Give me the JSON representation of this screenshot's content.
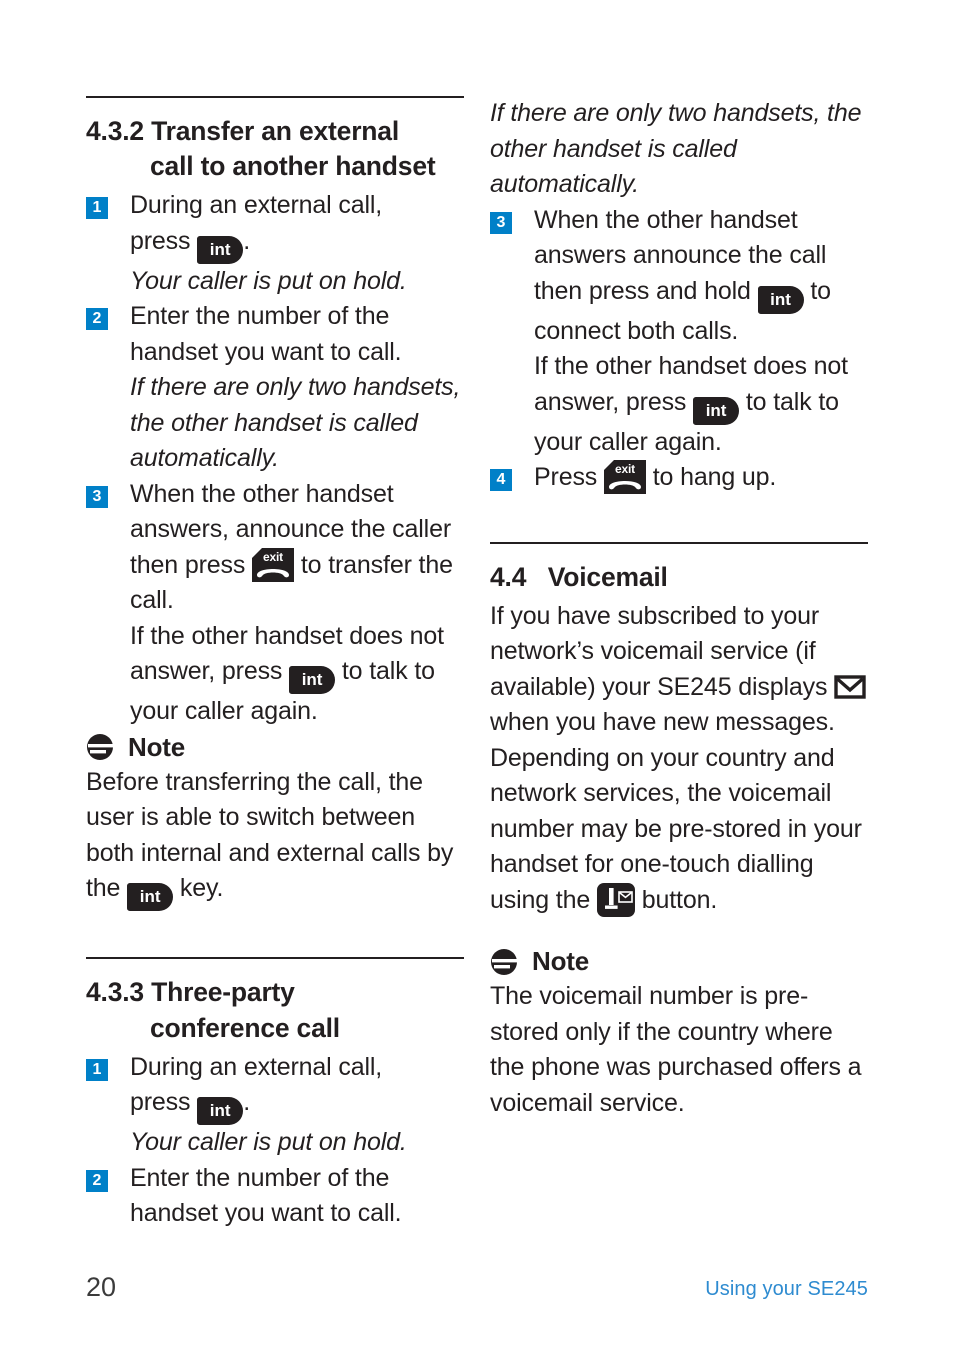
{
  "page": {
    "number": "20",
    "footer_note": "Using your SE245",
    "accent_blue": "#0080c8",
    "footer_blue": "#2e8bd0",
    "ink": "#231f20"
  },
  "icons": {
    "int_key_label": "int",
    "exit_key_label": "exit",
    "voicemail_key_digit": "1",
    "note_icon_name": "note-icon",
    "envelope_icon_name": "envelope-icon"
  },
  "left_column": {
    "section_432": {
      "number": "4.3.2",
      "title_line1": "Transfer an external",
      "title_line2": "call to another handset",
      "steps": [
        {
          "num": "1",
          "line_a_pre": "During an external call,",
          "line_b_pre": "press",
          "line_b_post": ".",
          "note_italic": "Your caller is put on hold."
        },
        {
          "num": "2",
          "text": "Enter the number of the handset you want to call.",
          "note_italic": "If there are only two handsets, the other handset is called automatically."
        },
        {
          "num": "3",
          "text_pre": "When the other handset answers, announce the caller then press",
          "text_post": "to transfer the call.",
          "extra_pre": "If the other handset does not answer, press",
          "extra_post": "to talk to your caller again."
        }
      ],
      "note": {
        "label": "Note",
        "text_pre": "Before transferring the call, the user is able to switch between both internal and external calls by the",
        "text_post": "key."
      }
    },
    "section_433": {
      "number": "4.3.3",
      "title_line1": "Three-party",
      "title_line2": "conference call",
      "steps": [
        {
          "num": "1",
          "line_a_pre": "During an external call,",
          "line_b_pre": "press",
          "line_b_post": ".",
          "note_italic": "Your caller is put on hold."
        },
        {
          "num": "2",
          "text": "Enter the number of the handset you want to call."
        }
      ]
    }
  },
  "right_column": {
    "continuation_italic": "If there are only two handsets, the other handset is called automatically.",
    "steps": [
      {
        "num": "3",
        "text_pre": "When the other handset answers announce the call then press and hold",
        "text_post": "to connect both calls.",
        "extra_pre": "If the other handset does not answer, press",
        "extra_post": "to talk to your caller again."
      },
      {
        "num": "4",
        "text_pre": "Press",
        "text_post": "to hang up."
      }
    ],
    "section_44": {
      "number": "4.4",
      "title": "Voicemail",
      "para1_pre": "If you have subscribed to your network’s voicemail service (if available) your SE245 displays",
      "para1_post": "when you have new messages.",
      "para2_pre": "Depending on your country and network services, the voicemail number may be pre-stored in your handset for one-touch dialling using the",
      "para2_post": "button.",
      "note": {
        "label": "Note",
        "text": "The voicemail number is pre-stored only if the country where the phone was purchased offers a voicemail service."
      }
    }
  }
}
